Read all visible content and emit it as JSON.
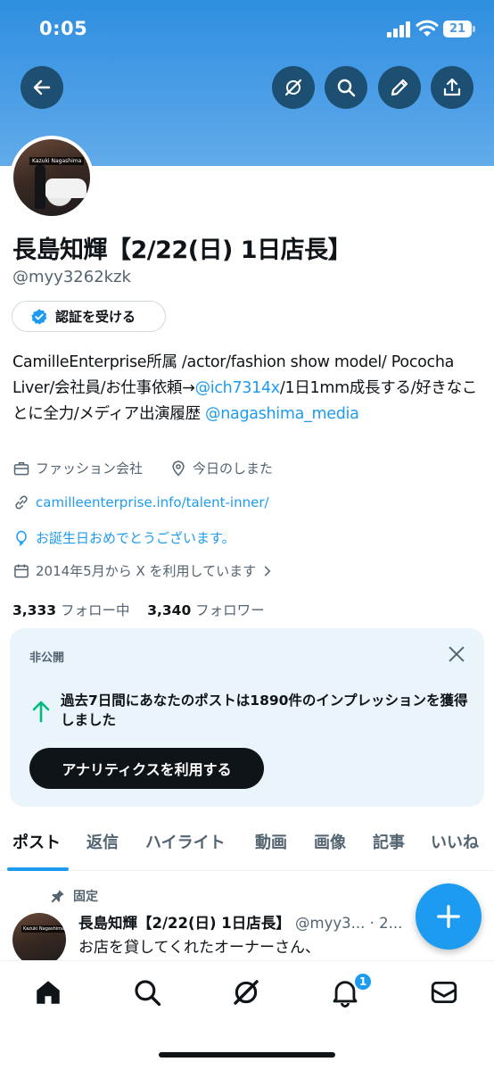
{
  "status": {
    "time": "0:05",
    "battery": "21"
  },
  "header": {
    "icons": [
      "back-arrow-icon",
      "grok-icon",
      "search-icon",
      "pencil-icon",
      "share-icon"
    ]
  },
  "profile": {
    "avatar_tag": "Kazuki Nagashima",
    "name": "長島知輝【2/22(日) 1日店長】",
    "handle": "@myy3262kzk",
    "verify_label": "認証を受ける",
    "bio_part1": "CamilleEnterprise所属 /actor/fashion show model/ Pococha Liver/会社員/お仕事依頼→",
    "bio_link1": "@ich7314x",
    "bio_part2": "/1日1mm成長する/好きなことに全力/メディア出演履歴 ",
    "bio_link2": "@nagashima_media",
    "category": "ファッション会社",
    "location": "今日のしまた",
    "website": "camilleenterprise.info/talent-inner/",
    "birthday": "お誕生日おめでとうございます。",
    "joined": "2014年5月から X を利用しています",
    "following_count": "3,333",
    "following_label": "フォロー中",
    "followers_count": "3,340",
    "followers_label": "フォロワー"
  },
  "analytics_card": {
    "label": "非公開",
    "text": "過去7日間にあなたのポストは1890件のインプレッションを獲得しました",
    "button": "アナリティクスを利用する",
    "colors": {
      "arrow": "#00ba7c",
      "bg": "#eaf4fb"
    }
  },
  "tabs": [
    {
      "label": "ポスト"
    },
    {
      "label": "返信"
    },
    {
      "label": "ハイライト"
    },
    {
      "label": "動画"
    },
    {
      "label": "画像"
    },
    {
      "label": "記事"
    },
    {
      "label": "いいね"
    }
  ],
  "pinned_post": {
    "pin_label": "固定",
    "name": "長島知輝【2/22(日) 1日店長】",
    "handle_time": "@myy3... · 2...",
    "text": "お店を貸してくれたオーナーさん、"
  },
  "bottom_nav": {
    "notification_badge": "1",
    "icons": [
      "home-icon",
      "search-icon",
      "grok-icon",
      "bell-icon",
      "mail-icon"
    ]
  },
  "colors": {
    "accent": "#1d9bf0",
    "banner": "#4a9de6",
    "text": "#0f1419",
    "muted": "#536471"
  }
}
